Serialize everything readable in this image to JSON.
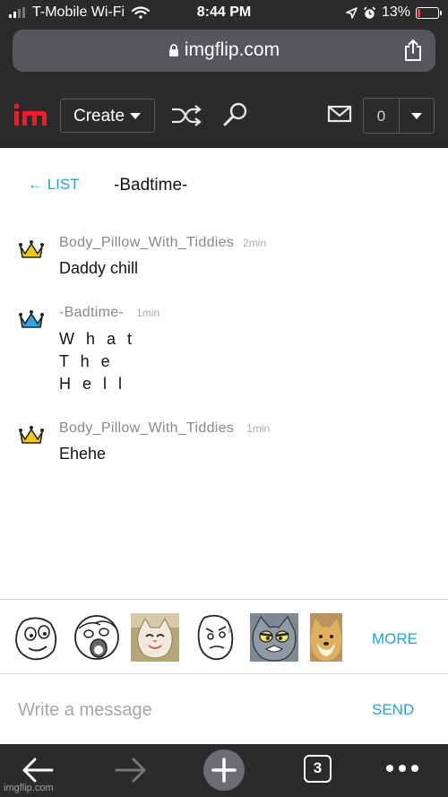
{
  "status_bar": {
    "carrier": "T-Mobile Wi-Fi",
    "time": "8:44 PM",
    "battery": "13%",
    "battery_level": 0.13,
    "icons": [
      "signal-icon",
      "wifi-icon",
      "location-icon",
      "alarm-icon",
      "battery-icon"
    ]
  },
  "browser": {
    "url": "imgflip.com",
    "tab_count": "3"
  },
  "nav": {
    "create_label": "Create",
    "notification_count": "0",
    "icons": [
      "imgflip-logo",
      "shuffle-icon",
      "search-icon",
      "mail-icon"
    ]
  },
  "chat": {
    "list_label": "← LIST",
    "title": "-Badtime-",
    "messages": [
      {
        "user": "Body_Pillow_With_Tiddies",
        "time": "2min",
        "text": "Daddy chill",
        "crown_color": "#f2c811"
      },
      {
        "user": "-Badtime-",
        "time": "1min",
        "text": "W h a t\nT h e\nH e l l",
        "crown_color": "#2aa8e0"
      },
      {
        "user": "Body_Pillow_With_Tiddies",
        "time": "1min",
        "text": "Ehehe",
        "crown_color": "#f2c811"
      }
    ]
  },
  "stickers": {
    "items": [
      "rage-face-sticker",
      "lol-face-sticker",
      "smiling-cat-sticker",
      "sweaty-face-sticker",
      "tom-cat-sticker",
      "doge-sticker"
    ],
    "more_label": "MORE"
  },
  "composer": {
    "placeholder": "Write a message",
    "send_label": "SEND"
  },
  "watermark": "imgflip.com",
  "colors": {
    "accent": "#1ea5d6",
    "chrome": "#2b2b2d",
    "brand_red": "#e8202a"
  }
}
